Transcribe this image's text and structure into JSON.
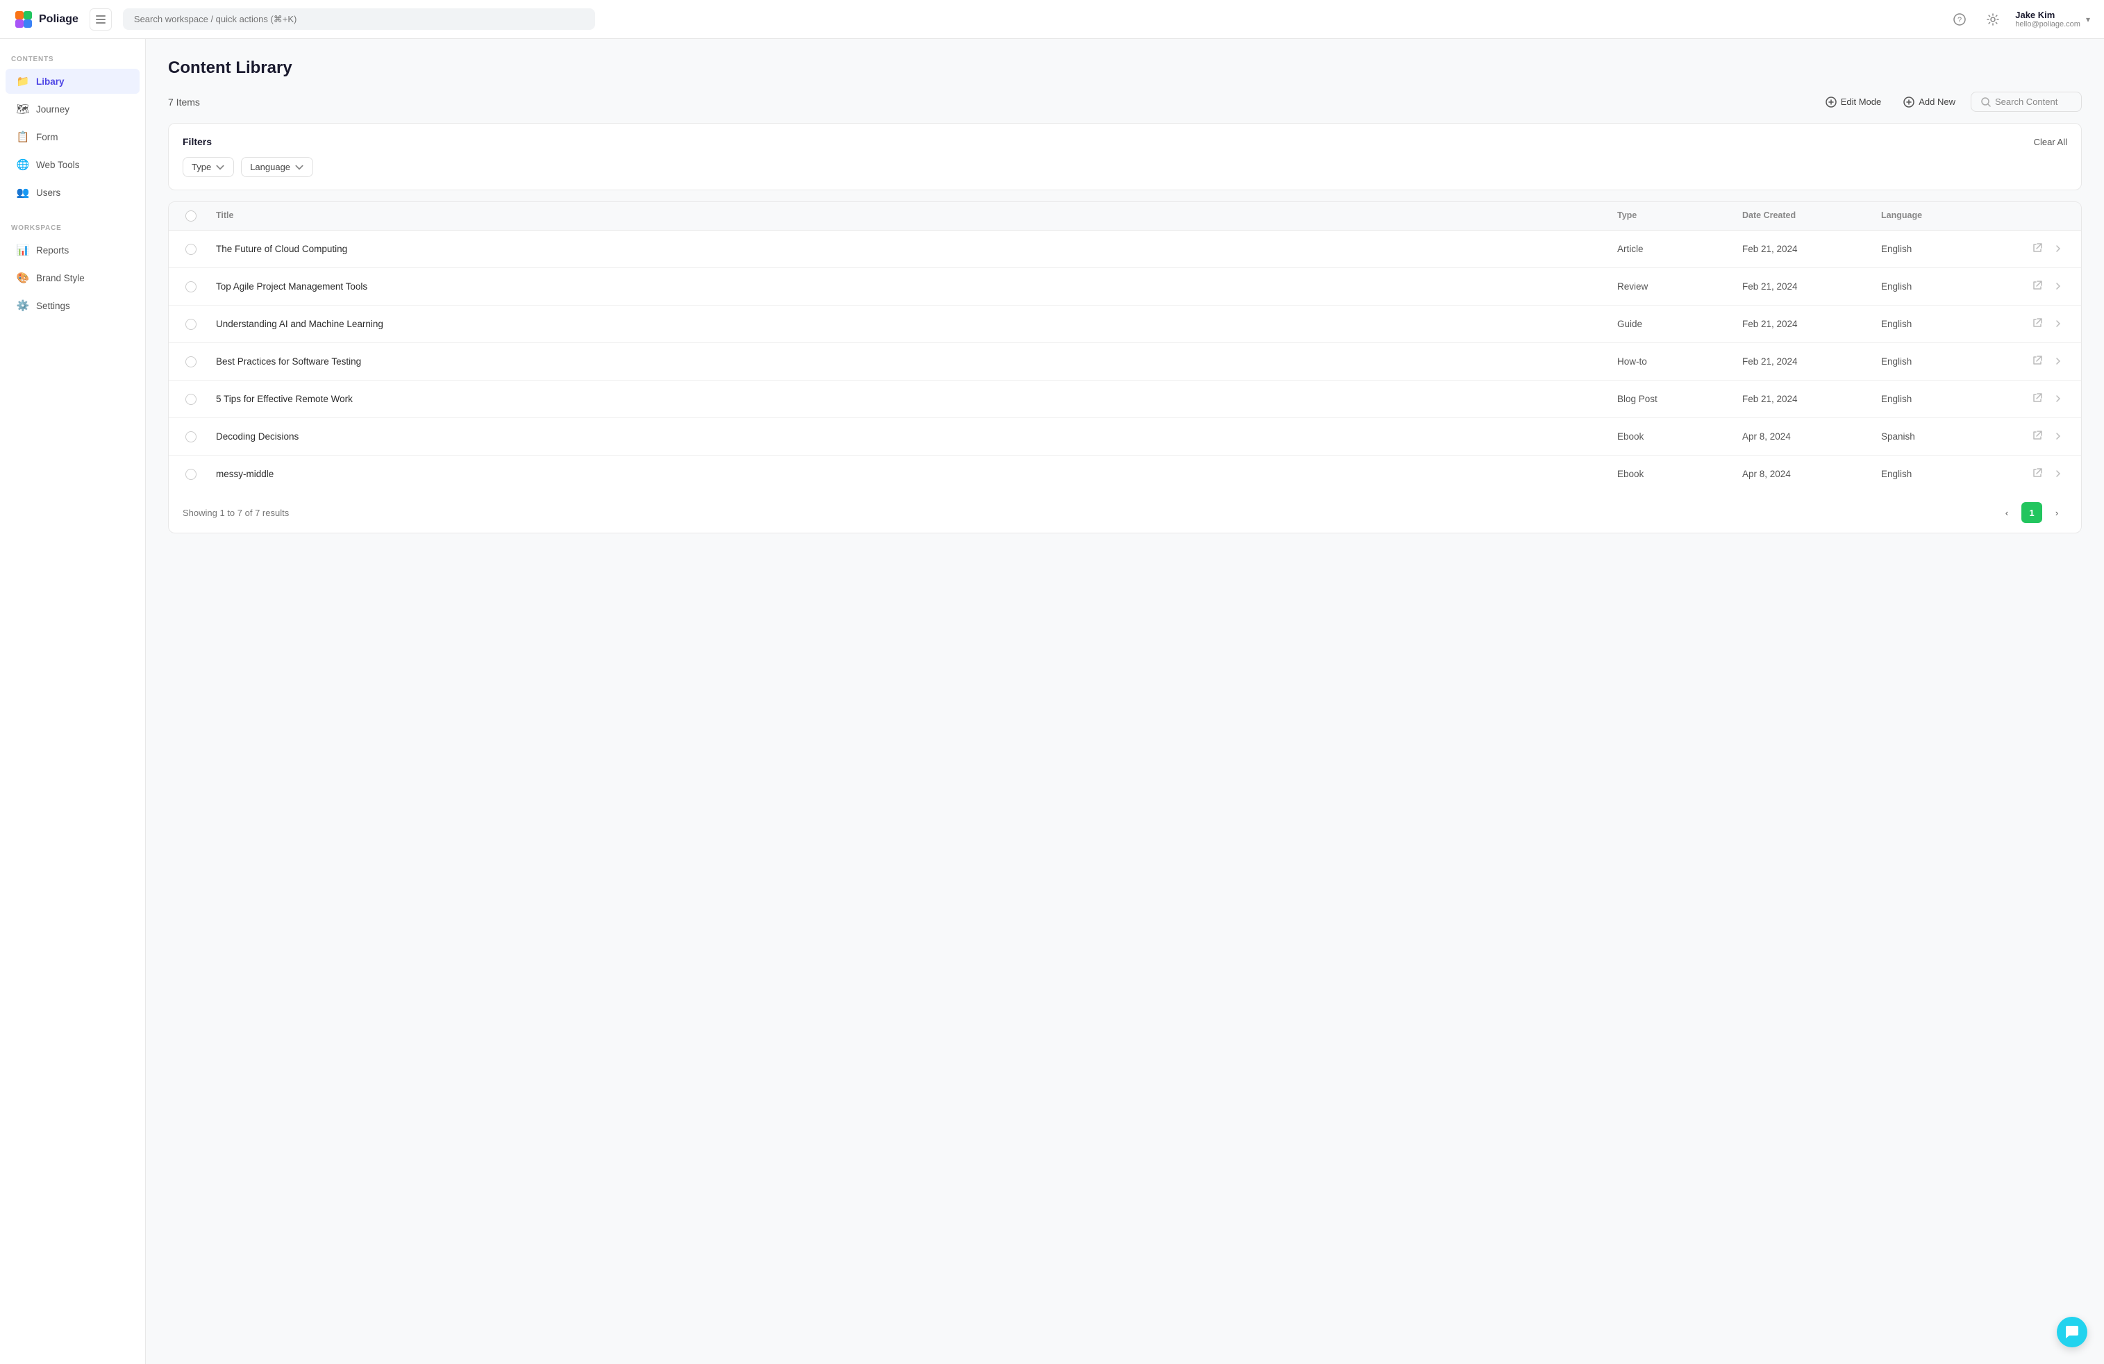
{
  "app": {
    "logo_text": "Poliage"
  },
  "topbar": {
    "search_placeholder": "Search workspace / quick actions (⌘+K)",
    "user_name": "Jake Kim",
    "user_email": "hello@poliage.com"
  },
  "sidebar": {
    "contents_label": "CONTENTS",
    "workspace_label": "WORKSPACE",
    "contents_items": [
      {
        "id": "library",
        "label": "Libary",
        "icon": "📁",
        "active": true
      },
      {
        "id": "journey",
        "label": "Journey",
        "icon": "🗺"
      },
      {
        "id": "form",
        "label": "Form",
        "icon": "📋"
      },
      {
        "id": "web-tools",
        "label": "Web Tools",
        "icon": "🌐"
      },
      {
        "id": "users",
        "label": "Users",
        "icon": "👥"
      }
    ],
    "workspace_items": [
      {
        "id": "reports",
        "label": "Reports",
        "icon": "📊"
      },
      {
        "id": "brand-style",
        "label": "Brand Style",
        "icon": "⚙"
      },
      {
        "id": "settings",
        "label": "Settings",
        "icon": "⚙"
      }
    ]
  },
  "page": {
    "title": "Content Library",
    "item_count": "7 Items",
    "edit_mode_label": "Edit Mode",
    "add_new_label": "Add New",
    "search_content_placeholder": "Search Content"
  },
  "filters": {
    "title": "Filters",
    "clear_all": "Clear All",
    "type_label": "Type",
    "language_label": "Language"
  },
  "table": {
    "columns": [
      "Title",
      "Type",
      "Date Created",
      "Language"
    ],
    "rows": [
      {
        "title": "The Future of Cloud Computing",
        "type": "Article",
        "date": "Feb 21, 2024",
        "language": "English"
      },
      {
        "title": "Top Agile Project Management Tools",
        "type": "Review",
        "date": "Feb 21, 2024",
        "language": "English"
      },
      {
        "title": "Understanding AI and Machine Learning",
        "type": "Guide",
        "date": "Feb 21, 2024",
        "language": "English"
      },
      {
        "title": "Best Practices for Software Testing",
        "type": "How-to",
        "date": "Feb 21, 2024",
        "language": "English"
      },
      {
        "title": "5 Tips for Effective Remote Work",
        "type": "Blog Post",
        "date": "Feb 21, 2024",
        "language": "English"
      },
      {
        "title": "Decoding Decisions",
        "type": "Ebook",
        "date": "Apr 8, 2024",
        "language": "Spanish"
      },
      {
        "title": "messy-middle",
        "type": "Ebook",
        "date": "Apr 8, 2024",
        "language": "English"
      }
    ]
  },
  "pagination": {
    "info": "Showing 1 to 7 of 7 results",
    "current_page": "1"
  }
}
